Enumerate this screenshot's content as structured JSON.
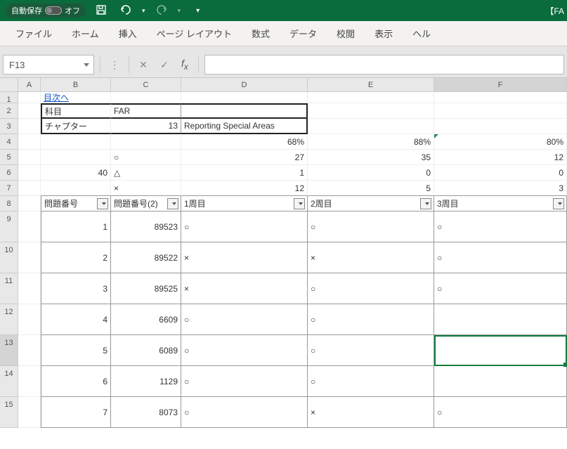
{
  "titlebar": {
    "autosave_label": "自動保存",
    "autosave_state": "オフ",
    "doc_title": "【FA"
  },
  "qat": {
    "save": "💾",
    "undo": "↩",
    "redo": "↪",
    "more": "▾"
  },
  "ribbon": {
    "tabs": [
      "ファイル",
      "ホーム",
      "挿入",
      "ページ レイアウト",
      "数式",
      "データ",
      "校閲",
      "表示",
      "ヘル"
    ]
  },
  "formula_bar": {
    "name_box": "F13",
    "cancel": "✕",
    "confirm": "✓",
    "fx": "fx",
    "value": ""
  },
  "columns": [
    "A",
    "B",
    "C",
    "D",
    "E",
    "F"
  ],
  "rows": [
    "1",
    "2",
    "3",
    "4",
    "5",
    "6",
    "7",
    "8",
    "9",
    "10",
    "11",
    "12",
    "13",
    "14",
    "15"
  ],
  "data": {
    "B1": "目次へ",
    "B2": "科目",
    "C2": "FAR",
    "B3": "チャプター",
    "C3": "13",
    "D3": "Reporting Special Areas",
    "D4": "68%",
    "E4": "88%",
    "F4": "80%",
    "C5": "○",
    "D5": "27",
    "E5": "35",
    "F5": "12",
    "B6": "40",
    "C6": "△",
    "D6": "1",
    "E6": "0",
    "F6": "0",
    "C7": "×",
    "D7": "12",
    "E7": "5",
    "F7": "3",
    "B8": "問題番号",
    "C8": "問題番号(2)",
    "D8": "1周目",
    "E8": "2周目",
    "F8": "3周目",
    "B9": "1",
    "C9": "89523",
    "D9": "○",
    "E9": "○",
    "F9": "○",
    "B10": "2",
    "C10": "89522",
    "D10": "×",
    "E10": "×",
    "F10": "○",
    "B11": "3",
    "C11": "89525",
    "D11": "×",
    "E11": "○",
    "F11": "○",
    "B12": "4",
    "C12": "6609",
    "D12": "○",
    "E12": "○",
    "F12": "",
    "B13": "5",
    "C13": "6089",
    "D13": "○",
    "E13": "○",
    "F13": "",
    "B14": "6",
    "C14": "1129",
    "D14": "○",
    "E14": "○",
    "F14": "",
    "B15": "7",
    "C15": "8073",
    "D15": "○",
    "E15": "×",
    "F15": "○"
  },
  "selection": {
    "cell": "F13"
  }
}
